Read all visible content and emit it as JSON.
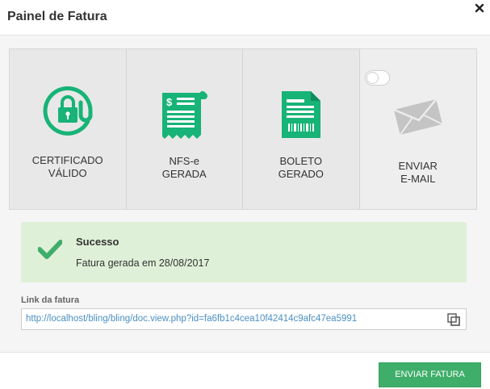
{
  "dialog": {
    "title": "Painel de Fatura",
    "close_icon": "close-icon"
  },
  "steps": [
    {
      "icon": "lock-at-icon",
      "line1": "CERTIFICADO",
      "line2": "VÁLIDO",
      "status": "done"
    },
    {
      "icon": "receipt-icon",
      "line1": "NFS-e",
      "line2": "GERADA",
      "status": "done"
    },
    {
      "icon": "barcode-document-icon",
      "line1": "BOLETO",
      "line2": "GERADO",
      "status": "done"
    },
    {
      "icon": "envelope-icon",
      "line1": "ENVIAR",
      "line2": "E-MAIL",
      "status": "pending",
      "toggle_on": false
    }
  ],
  "alert": {
    "icon": "check-icon",
    "title": "Sucesso",
    "message": "Fatura gerada em 28/08/2017"
  },
  "link": {
    "label": "Link da fatura",
    "value": "http://localhost/bling/bling/doc.view.php?id=fa6fb1c4cea10f42414c9afc47ea5991",
    "copy_icon": "copy-icon"
  },
  "footer": {
    "send_label": "ENVIAR FATURA"
  },
  "colors": {
    "accent": "#17b377",
    "success_bg": "#dff0d8",
    "button": "#3fae6a",
    "link": "#4a90c2"
  }
}
